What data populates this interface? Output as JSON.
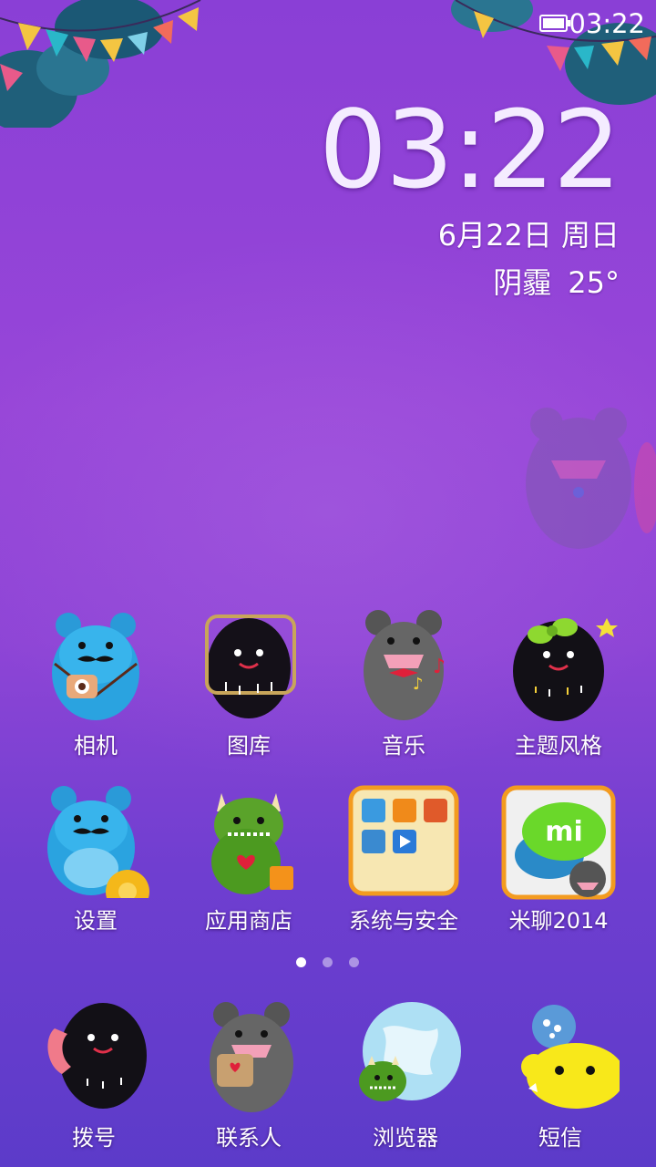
{
  "status_bar": {
    "time": "03:22",
    "battery_icon": "battery-icon"
  },
  "clock_widget": {
    "time": "03:22",
    "date": "6月22日 周日",
    "weather": "阴霾",
    "temperature": "25°"
  },
  "apps": [
    {
      "label": "相机",
      "icon": "camera-bear-icon"
    },
    {
      "label": "图库",
      "icon": "gallery-monster-icon"
    },
    {
      "label": "音乐",
      "icon": "music-bear-icon"
    },
    {
      "label": "主题风格",
      "icon": "theme-monster-icon"
    },
    {
      "label": "设置",
      "icon": "settings-bear-icon"
    },
    {
      "label": "应用商店",
      "icon": "app-store-monster-icon"
    },
    {
      "label": "系统与安全",
      "icon": "folder-icon"
    },
    {
      "label": "米聊2014",
      "icon": "miliao-icon"
    }
  ],
  "pager": {
    "pages": 3,
    "current": 1
  },
  "dock": [
    {
      "label": "拨号",
      "icon": "dialer-monster-icon"
    },
    {
      "label": "联系人",
      "icon": "contacts-bear-icon"
    },
    {
      "label": "浏览器",
      "icon": "browser-globe-icon"
    },
    {
      "label": "短信",
      "icon": "sms-monster-icon"
    }
  ],
  "colors": {
    "wallpaper_top": "#8a3fd6",
    "wallpaper_bottom": "#5c3bc9",
    "text": "#ffffff"
  }
}
